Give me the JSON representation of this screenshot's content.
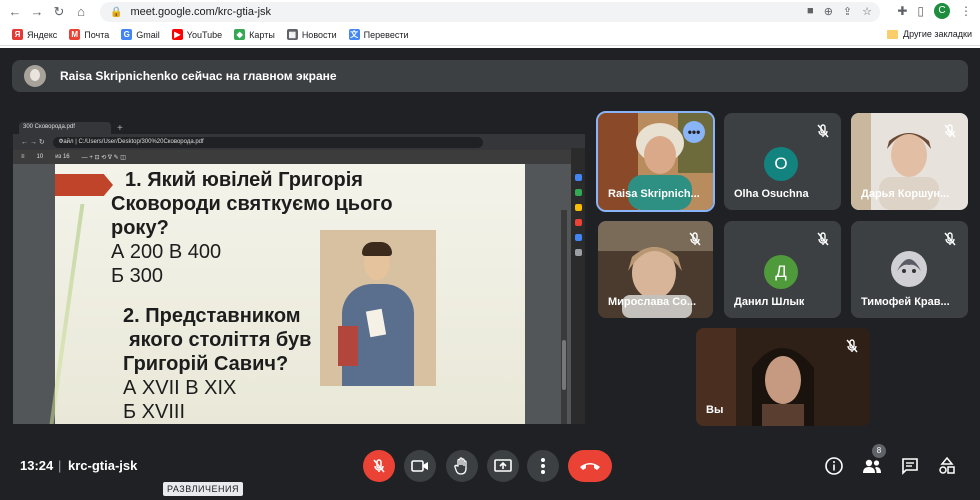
{
  "browser": {
    "url": "meet.google.com/krc-gtia-jsk",
    "profile_initial": "C",
    "bookmarks": [
      {
        "label": "Яндекс",
        "color": "#e53935",
        "glyph": "Я"
      },
      {
        "label": "Почта",
        "color": "#ea4335",
        "glyph": "M"
      },
      {
        "label": "Gmail",
        "color": "#4285f4",
        "glyph": "G"
      },
      {
        "label": "YouTube",
        "color": "#ff0000",
        "glyph": "▶"
      },
      {
        "label": "Карты",
        "color": "#34a853",
        "glyph": "◆"
      },
      {
        "label": "Новости",
        "color": "#5f6368",
        "glyph": "▦"
      },
      {
        "label": "Перевести",
        "color": "#4285f4",
        "glyph": "文"
      }
    ],
    "other_bookmarks": "Другие закладки"
  },
  "banner": {
    "text": "Raisa Skripnichenko сейчас на главном экране"
  },
  "shared_screen": {
    "tab_title": "300 Сковорода.pdf",
    "address": "C:/Users/User/Desktop/300%20Сковорода.pdf",
    "file_label": "Файл",
    "page_current": "10",
    "page_total": "из 16",
    "slide": {
      "q1_lines": [
        "1.  Який ювілей Григорія",
        "Сковороди святкуємо цього",
        "року?"
      ],
      "q1_answers": [
        "А 200      В 400",
        "Б 300"
      ],
      "q2_lines": [
        "2.  Представником",
        "якого століття був",
        "Григорій Савич?"
      ],
      "q2_answers": [
        "А XVII          В XIX",
        "Б XVIII"
      ]
    }
  },
  "participants": [
    {
      "name": "Raisa Skripnich...",
      "type": "video",
      "active": true
    },
    {
      "name": "Olha Osuchna",
      "type": "letter",
      "letter": "O",
      "color": "#12837f"
    },
    {
      "name": "Дарья Коршун...",
      "type": "video"
    },
    {
      "name": "Мирослава Со...",
      "type": "video"
    },
    {
      "name": "Данил Шлык",
      "type": "letter",
      "letter": "Д",
      "color": "#4f9a3b"
    },
    {
      "name": "Тимофей Крав...",
      "type": "avatar"
    },
    {
      "name": "Вы",
      "type": "video"
    }
  ],
  "bottom": {
    "time": "13:24",
    "separator": "|",
    "meeting_code": "krc-gtia-jsk",
    "tooltip": "РАЗВЛИЧЕНИЯ",
    "people_count": "8"
  }
}
